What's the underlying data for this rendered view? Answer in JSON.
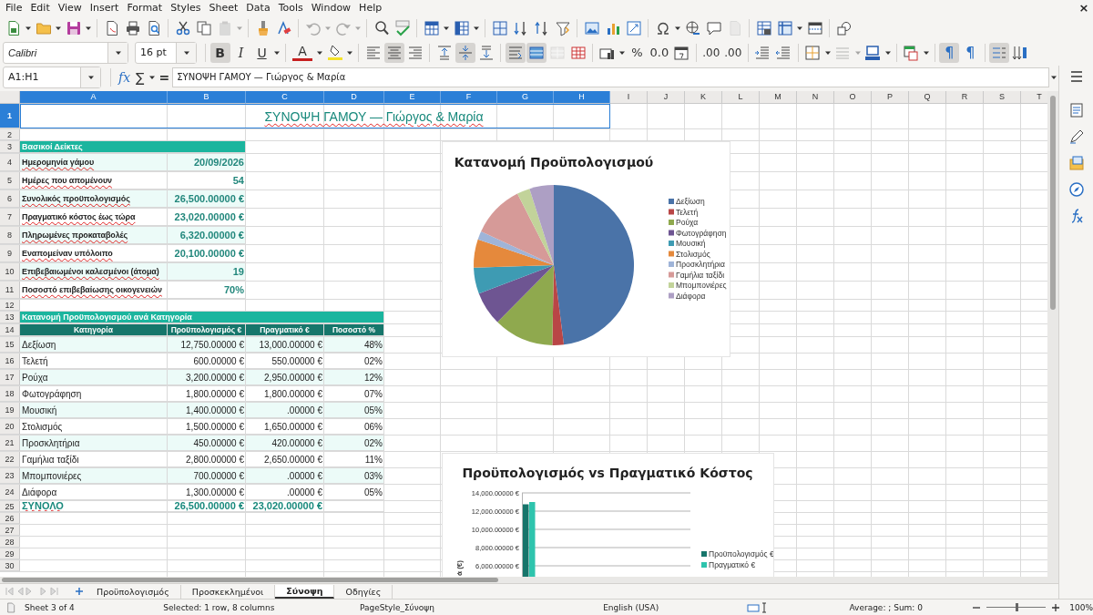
{
  "window": {
    "close_glyph": "×"
  },
  "menu": [
    "File",
    "Edit",
    "View",
    "Insert",
    "Format",
    "Styles",
    "Sheet",
    "Data",
    "Tools",
    "Window",
    "Help"
  ],
  "standard_toolbar": [
    {
      "disabled": false
    },
    {
      "disabled": false
    },
    {
      "disabled": false
    },
    {
      "disabled": false
    },
    {
      "disabled": false
    },
    {
      "disabled": false
    },
    {
      "disabled": false
    },
    {
      "disabled": false
    },
    {
      "disabled": true
    },
    {
      "disabled": false
    },
    {
      "disabled": false
    },
    {
      "disabled": true
    },
    {
      "disabled": true
    },
    {
      "disabled": false
    },
    {
      "disabled": false
    },
    {
      "disabled": false
    },
    {
      "disabled": false
    },
    {
      "disabled": false
    },
    {
      "disabled": false
    },
    {
      "disabled": false
    },
    {
      "disabled": false
    },
    {
      "disabled": false
    },
    {
      "disabled": false
    },
    {
      "disabled": false
    },
    {
      "disabled": false
    },
    {
      "disabled": false
    },
    {
      "disabled": false
    },
    {
      "disabled": true
    },
    {
      "disabled": false
    },
    {
      "disabled": false
    },
    {
      "disabled": false
    },
    {
      "disabled": false
    }
  ],
  "formatting_toolbar": {
    "font_name": "Calibri",
    "font_size": "16 pt",
    "buttons": [
      {
        "label": "B",
        "pressed": true,
        "disabled": false
      },
      {
        "label": "I",
        "pressed": false,
        "disabled": false
      },
      {
        "label": "U",
        "pressed": false,
        "disabled": false
      },
      {
        "label": "A",
        "pressed": false,
        "disabled": false
      },
      {
        "pressed": false,
        "disabled": false
      },
      {
        "pressed": false,
        "disabled": false
      },
      {
        "pressed": true,
        "disabled": false
      },
      {
        "pressed": false,
        "disabled": false
      },
      {
        "pressed": false,
        "disabled": false
      },
      {
        "pressed": true,
        "disabled": false
      },
      {
        "pressed": false,
        "disabled": false
      },
      {
        "pressed": true,
        "disabled": false
      },
      {
        "pressed": true,
        "disabled": false
      },
      {
        "pressed": false,
        "disabled": true
      },
      {
        "pressed": false,
        "disabled": false
      },
      {
        "pressed": false,
        "disabled": false
      },
      {
        "label": "%",
        "pressed": false,
        "disabled": false
      },
      {
        "label": "0.0",
        "pressed": false,
        "disabled": false
      },
      {
        "pressed": false,
        "disabled": false
      },
      {
        "label": ".00",
        "pressed": false,
        "disabled": false
      },
      {
        "label": ".00",
        "pressed": false,
        "disabled": false
      },
      {
        "pressed": false,
        "disabled": false
      },
      {
        "pressed": false,
        "disabled": false
      },
      {
        "pressed": false,
        "disabled": false
      },
      {
        "pressed": false,
        "disabled": true
      },
      {
        "pressed": false,
        "disabled": false
      },
      {
        "pressed": false,
        "disabled": false
      },
      {
        "label": "¶",
        "pressed": true,
        "disabled": false
      },
      {
        "label": "¶",
        "pressed": false,
        "disabled": false
      },
      {
        "pressed": true,
        "disabled": false
      },
      {
        "pressed": false,
        "disabled": false
      }
    ]
  },
  "formula_bar": {
    "name_box": "A1:H1",
    "function_glyph": "fx",
    "sum_glyph": "∑",
    "equals_glyph": "=",
    "content": "ΣΥΝΟΨΗ ΓΑΜΟΥ — Γιώργος & Μαρία"
  },
  "columns": [
    {
      "label": "A",
      "selected": true
    },
    {
      "label": "B",
      "selected": true
    },
    {
      "label": "C",
      "selected": true
    },
    {
      "label": "D",
      "selected": true
    },
    {
      "label": "E",
      "selected": true
    },
    {
      "label": "F",
      "selected": true
    },
    {
      "label": "G",
      "selected": true
    },
    {
      "label": "H",
      "selected": true
    },
    {
      "label": "I",
      "selected": false
    },
    {
      "label": "J",
      "selected": false
    },
    {
      "label": "K",
      "selected": false
    },
    {
      "label": "L",
      "selected": false
    },
    {
      "label": "M",
      "selected": false
    },
    {
      "label": "N",
      "selected": false
    },
    {
      "label": "O",
      "selected": false
    },
    {
      "label": "P",
      "selected": false
    },
    {
      "label": "Q",
      "selected": false
    },
    {
      "label": "R",
      "selected": false
    },
    {
      "label": "S",
      "selected": false
    },
    {
      "label": "T",
      "selected": false
    }
  ],
  "rows": [
    {
      "number": "1",
      "selected": true,
      "kind": "title",
      "misspelled": true,
      "cells": [
        "ΣΥΝΟΨΗ ΓΑΜΟΥ — Γιώργος & Μαρία"
      ]
    },
    {
      "number": "2",
      "selected": false,
      "kind": "blank"
    },
    {
      "number": "3",
      "selected": false,
      "kind": "section",
      "misspelled": true,
      "cells": [
        "Βασικοί Δείκτες"
      ]
    },
    {
      "number": "4",
      "selected": false,
      "kind": "metric",
      "shaded": true,
      "misspelled": true,
      "cells": [
        "Ημερομηνία γάμου",
        "20/09/2026"
      ]
    },
    {
      "number": "5",
      "selected": false,
      "kind": "metric",
      "shaded": false,
      "misspelled": true,
      "cells": [
        "Ημέρες που απομένουν",
        "54"
      ]
    },
    {
      "number": "6",
      "selected": false,
      "kind": "metric",
      "shaded": true,
      "misspelled": true,
      "cells": [
        "Συνολικός προϋπολογισμός",
        "26,500.00000 €"
      ]
    },
    {
      "number": "7",
      "selected": false,
      "kind": "metric",
      "shaded": false,
      "misspelled": true,
      "cells": [
        "Πραγματικό κόστος έως τώρα",
        "23,020.00000 €"
      ]
    },
    {
      "number": "8",
      "selected": false,
      "kind": "metric",
      "shaded": true,
      "misspelled": true,
      "cells": [
        "Πληρωμένες προκαταβολές",
        "6,320.00000 €"
      ]
    },
    {
      "number": "9",
      "selected": false,
      "kind": "metric",
      "shaded": false,
      "misspelled": true,
      "cells": [
        "Εναπομείναν υπόλοιπο",
        "20,100.00000 €"
      ]
    },
    {
      "number": "10",
      "selected": false,
      "kind": "metric",
      "shaded": true,
      "misspelled": true,
      "cells": [
        "Επιβεβαιωμένοι καλεσμένοι (άτομα)",
        "19"
      ]
    },
    {
      "number": "11",
      "selected": false,
      "kind": "metric",
      "shaded": false,
      "misspelled": true,
      "cells": [
        "Ποσοστό επιβεβαίωσης οικογενειών",
        "70%"
      ]
    },
    {
      "number": "12",
      "selected": false,
      "kind": "blank"
    },
    {
      "number": "13",
      "selected": false,
      "kind": "section",
      "misspelled": true,
      "cells": [
        "Κατανομή Προϋπολογισμού ανά Κατηγορία"
      ]
    },
    {
      "number": "14",
      "selected": false,
      "kind": "header",
      "cells": [
        "Κατηγορία",
        "Προϋπολογισμός €",
        "Πραγματικό €",
        "Ποσοστό %"
      ]
    },
    {
      "number": "15",
      "selected": false,
      "kind": "item",
      "shaded": true,
      "cells": [
        "Δεξίωση",
        "12,750.00000 €",
        "13,000.00000 €",
        "48%"
      ]
    },
    {
      "number": "16",
      "selected": false,
      "kind": "item",
      "shaded": false,
      "cells": [
        "Τελετή",
        "600.00000 €",
        "550.00000 €",
        "02%"
      ]
    },
    {
      "number": "17",
      "selected": false,
      "kind": "item",
      "shaded": true,
      "cells": [
        "Ρούχα",
        "3,200.00000 €",
        "2,950.00000 €",
        "12%"
      ]
    },
    {
      "number": "18",
      "selected": false,
      "kind": "item",
      "shaded": false,
      "cells": [
        "Φωτογράφηση",
        "1,800.00000 €",
        "1,800.00000 €",
        "07%"
      ]
    },
    {
      "number": "19",
      "selected": false,
      "kind": "item",
      "shaded": true,
      "cells": [
        "Μουσική",
        "1,400.00000 €",
        ".00000 €",
        "05%"
      ]
    },
    {
      "number": "20",
      "selected": false,
      "kind": "item",
      "shaded": false,
      "cells": [
        "Στολισμός",
        "1,500.00000 €",
        "1,650.00000 €",
        "06%"
      ]
    },
    {
      "number": "21",
      "selected": false,
      "kind": "item",
      "shaded": true,
      "cells": [
        "Προσκλητήρια",
        "450.00000 €",
        "420.00000 €",
        "02%"
      ]
    },
    {
      "number": "22",
      "selected": false,
      "kind": "item",
      "shaded": false,
      "cells": [
        "Γαμήλια ταξίδι",
        "2,800.00000 €",
        "2,650.00000 €",
        "11%"
      ]
    },
    {
      "number": "23",
      "selected": false,
      "kind": "item",
      "shaded": true,
      "cells": [
        "Μπομπονιέρες",
        "700.00000 €",
        ".00000 €",
        "03%"
      ]
    },
    {
      "number": "24",
      "selected": false,
      "kind": "item",
      "shaded": false,
      "cells": [
        "Διάφορα",
        "1,300.00000 €",
        ".00000 €",
        "05%"
      ]
    },
    {
      "number": "25",
      "selected": false,
      "kind": "total",
      "misspelled": true,
      "cells": [
        "ΣΥΝΟΛΟ",
        "26,500.00000 €",
        "23,020.00000 €"
      ]
    },
    {
      "number": "26",
      "selected": false,
      "kind": "blank"
    },
    {
      "number": "27",
      "selected": false,
      "kind": "blank"
    },
    {
      "number": "28",
      "selected": false,
      "kind": "blank"
    },
    {
      "number": "29",
      "selected": false,
      "kind": "blank"
    },
    {
      "number": "30",
      "selected": false,
      "kind": "blank"
    }
  ],
  "charts": [
    {
      "chart_data": {
        "type": "pie",
        "title": "Κατανομή Προϋπολογισμού",
        "legend": "right",
        "categories": [
          "Δεξίωση",
          "Τελετή",
          "Ρούχα",
          "Φωτογράφηση",
          "Μουσική",
          "Στολισμός",
          "Προσκλητήρια",
          "Γαμήλια ταξίδι",
          "Μπομπονιέρες",
          "Διάφορα"
        ],
        "colors": [
          "#4a73a8",
          "#b94646",
          "#8fa94e",
          "#6e5592",
          "#3e9bb3",
          "#e5893c",
          "#9fb4d8",
          "#d69a98",
          "#c2d39a",
          "#ad9fc4"
        ],
        "values": [
          48.0,
          2.3,
          12.1,
          6.8,
          5.3,
          5.7,
          1.7,
          10.6,
          2.6,
          4.9
        ]
      }
    },
    {
      "chart_data": {
        "type": "bar",
        "title": "Προϋπολογισμός vs Πραγματικό Κόστος",
        "ylabel": "ά (€)",
        "legend": "right",
        "stacked": false,
        "grid": true,
        "ylim": [
          0,
          14000
        ],
        "yticks": [
          {
            "value": 14000,
            "label": "14,000.00000 €"
          },
          {
            "value": 12000,
            "label": "12,000.00000 €"
          },
          {
            "value": 10000,
            "label": "10,000.00000 €"
          },
          {
            "value": 8000,
            "label": "8,000.00000 €"
          },
          {
            "value": 6000,
            "label": "6,000.00000 €"
          }
        ],
        "series": [
          {
            "name": "Προϋπολογισμός €",
            "color": "#17756b",
            "values": [
              12750
            ]
          },
          {
            "name": "Πραγματικό €",
            "color": "#2ec4ad",
            "values": [
              13000
            ]
          }
        ]
      }
    }
  ],
  "sheet_tabs": [
    {
      "label": "Προϋπολογισμός",
      "selected": false
    },
    {
      "label": "Προσκεκλημένοι",
      "selected": false
    },
    {
      "label": "Σύνοψη",
      "selected": true
    },
    {
      "label": "Οδηγίες",
      "selected": false
    }
  ],
  "status_bar": {
    "sheet": "Sheet 3 of 4",
    "selection": "Selected: 1 row, 8 columns",
    "page_style": "PageStyle_Σύνοψη",
    "language": "English (USA)",
    "summary": "Average: ; Sum: 0",
    "zoom_slider": {
      "level": 0.5
    },
    "zoom": "100%"
  }
}
